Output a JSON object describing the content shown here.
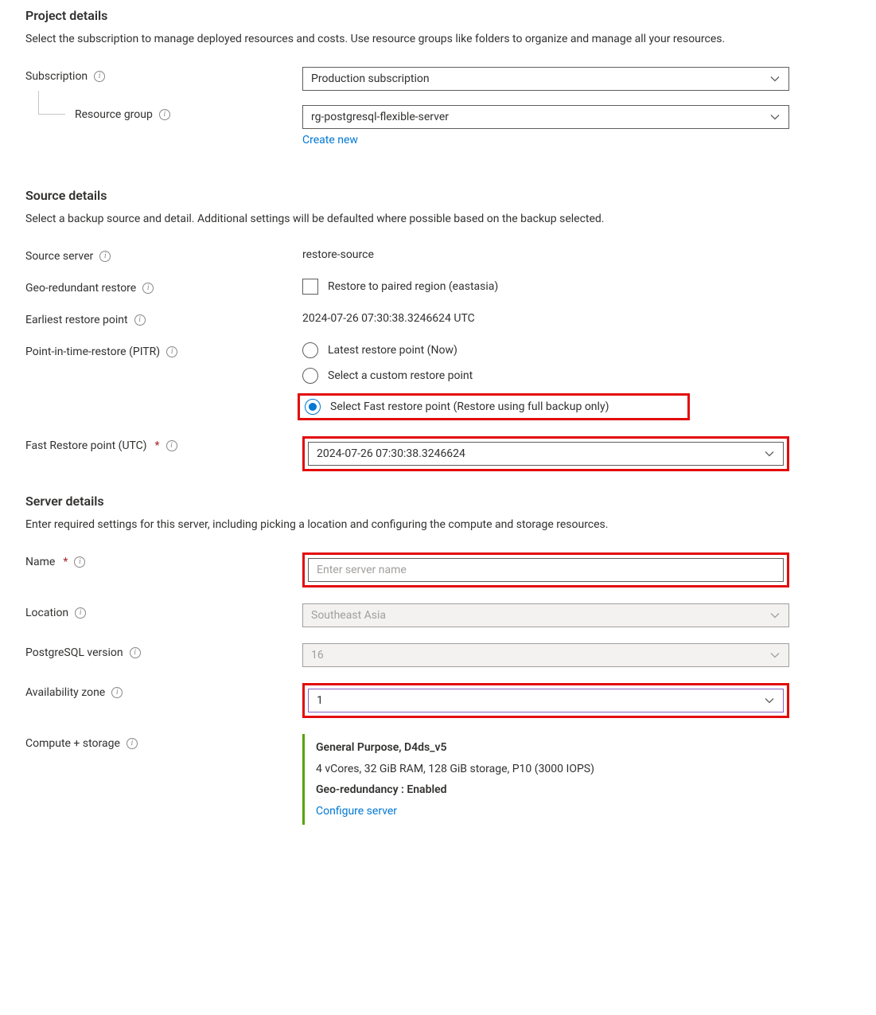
{
  "project": {
    "title": "Project details",
    "desc": "Select the subscription to manage deployed resources and costs. Use resource groups like folders to organize and manage all your resources.",
    "subscription_label": "Subscription",
    "subscription_value": "Production subscription",
    "resource_group_label": "Resource group",
    "resource_group_value": "rg-postgresql-flexible-server",
    "create_new": "Create new"
  },
  "source": {
    "title": "Source details",
    "desc": "Select a backup source and detail. Additional settings will be defaulted where possible based on the backup selected.",
    "source_server_label": "Source server",
    "source_server_value": "restore-source",
    "geo_label": "Geo-redundant restore",
    "geo_checkbox_label": "Restore to paired region (eastasia)",
    "earliest_label": "Earliest restore point",
    "earliest_value": "2024-07-26 07:30:38.3246624 UTC",
    "pitr_label": "Point-in-time-restore (PITR)",
    "pitr_options": {
      "latest": "Latest restore point (Now)",
      "custom": "Select a custom restore point",
      "fast": "Select Fast restore point (Restore using full backup only)"
    },
    "fast_restore_label": "Fast Restore point (UTC)",
    "fast_restore_value": "2024-07-26 07:30:38.3246624"
  },
  "server": {
    "title": "Server details",
    "desc": "Enter required settings for this server, including picking a location and configuring the compute and storage resources.",
    "name_label": "Name",
    "name_placeholder": "Enter server name",
    "name_value": "",
    "location_label": "Location",
    "location_value": "Southeast Asia",
    "version_label": "PostgreSQL version",
    "version_value": "16",
    "az_label": "Availability zone",
    "az_value": "1",
    "compute_label": "Compute + storage",
    "compute": {
      "tier": "General Purpose, D4ds_v5",
      "spec": "4 vCores, 32 GiB RAM, 128 GiB storage, P10 (3000 IOPS)",
      "geo": "Geo-redundancy : Enabled",
      "configure": "Configure server"
    }
  }
}
